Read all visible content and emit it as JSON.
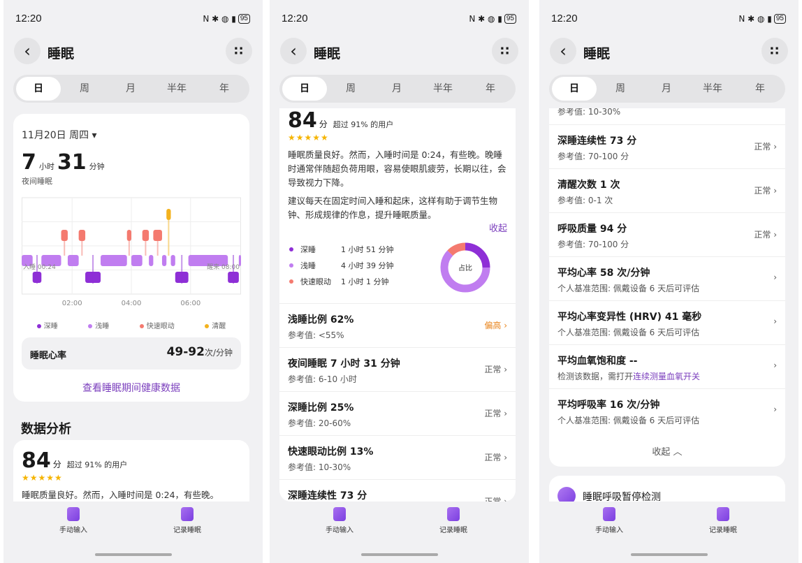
{
  "status": {
    "time": "12:20",
    "icons": "N ✱ ◍ ▮",
    "battery": "95"
  },
  "header": {
    "back": "‹",
    "title": "睡眠",
    "more": "∷"
  },
  "tabs": [
    "日",
    "周",
    "月",
    "半年",
    "年"
  ],
  "screen1": {
    "date": "11月20日 周四 ▾",
    "duration": {
      "hours": "7",
      "h_unit": "小时",
      "minutes": "31",
      "m_unit": "分钟"
    },
    "duration_label": "夜间睡眠",
    "chart_data": {
      "type": "area",
      "x_start_label": "入睡 00:24",
      "x_end_label": "醒来 08:00",
      "x_ticks": [
        "02:00",
        "04:00",
        "06:00"
      ],
      "legend": [
        "深睡",
        "浅睡",
        "快速眼动",
        "清醒"
      ],
      "colors": {
        "深睡": "#8e2fd6",
        "浅睡": "#c07df0",
        "快速眼动": "#f47a6f",
        "清醒": "#f3b21e"
      },
      "stages": [
        [
          "浅睡",
          0.0,
          0.05
        ],
        [
          "深睡",
          0.05,
          0.09
        ],
        [
          "浅睡",
          0.09,
          0.18
        ],
        [
          "快速眼动",
          0.18,
          0.21
        ],
        [
          "浅睡",
          0.21,
          0.26
        ],
        [
          "快速眼动",
          0.26,
          0.29
        ],
        [
          "深睡",
          0.29,
          0.36
        ],
        [
          "浅睡",
          0.36,
          0.48
        ],
        [
          "快速眼动",
          0.48,
          0.5
        ],
        [
          "浅睡",
          0.5,
          0.55
        ],
        [
          "快速眼动",
          0.55,
          0.58
        ],
        [
          "浅睡",
          0.58,
          0.6
        ],
        [
          "快速眼动",
          0.6,
          0.64
        ],
        [
          "浅睡",
          0.64,
          0.66
        ],
        [
          "清醒",
          0.66,
          0.68
        ],
        [
          "浅睡",
          0.68,
          0.7
        ],
        [
          "深睡",
          0.7,
          0.76
        ],
        [
          "浅睡",
          0.76,
          0.94
        ],
        [
          "深睡",
          0.94,
          0.99
        ],
        [
          "浅睡",
          0.99,
          1.0
        ]
      ]
    },
    "heart_rate": {
      "label": "睡眠心率",
      "value": "49-92",
      "unit": "次/分钟"
    },
    "link": "查看睡眠期间健康数据",
    "section_title": "数据分析"
  },
  "analysis": {
    "score": "84",
    "score_unit": "分",
    "beat": "超过 91% 的用户",
    "stars": "★★★★★",
    "para1": "睡眠质量良好。然而，入睡时间是 0:24，有些晚。晚睡时通常伴随超负荷用眼，容易使眼肌疲劳，长期以往，会导致视力下降。",
    "para1_short": "睡眠质量良好。然而，入睡时间是 0:24，有些晚。",
    "para2": "建议每天在固定时间入睡和起床，这样有助于调节生物钟、形成规律的作息，提升睡眠质量。",
    "collapse": "收起"
  },
  "composition": {
    "center": "占比",
    "items": [
      {
        "name": "深睡",
        "value": "1 小时 51 分钟",
        "color": "#8e2fd6",
        "pct": 25
      },
      {
        "name": "浅睡",
        "value": "4 小时 39 分钟",
        "color": "#c07df0",
        "pct": 62
      },
      {
        "name": "快速眼动",
        "value": "1 小时 1 分钟",
        "color": "#f47a6f",
        "pct": 13
      }
    ]
  },
  "metrics": [
    {
      "title": "浅睡比例 62%",
      "sub": "参考值: <55%",
      "status": "偏高 ›",
      "warn": true
    },
    {
      "title": "夜间睡眠 7 小时 31 分钟",
      "sub": "参考值: 6-10 小时",
      "status": "正常 ›"
    },
    {
      "title": "深睡比例 25%",
      "sub": "参考值: 20-60%",
      "status": "正常 ›"
    },
    {
      "title": "快速眼动比例 13%",
      "sub": "参考值: 10-30%",
      "status": "正常 ›"
    },
    {
      "title": "深睡连续性 73 分",
      "sub": "参考值: 70-100 分",
      "status": "正常 ›"
    },
    {
      "title": "清醒次数 1 次",
      "sub": "参考值: 0-1 次",
      "status": "正常 ›"
    },
    {
      "title": "呼吸质量 94 分",
      "sub": "参考值: 70-100 分",
      "status": "正常 ›"
    },
    {
      "title": "平均心率 58 次/分钟",
      "sub": "个人基准范围: 佩戴设备 6 天后可评估",
      "status": "›"
    },
    {
      "title": "平均心率变异性 (HRV) 41 毫秒",
      "sub": "个人基准范围: 佩戴设备 6 天后可评估",
      "status": "›"
    },
    {
      "title": "平均血氧饱和度 --",
      "sub": "检测该数据，需打开",
      "sub_link": "连续测量血氧开关",
      "status": "›"
    },
    {
      "title": "平均呼吸率 16 次/分钟",
      "sub": "个人基准范围: 佩戴设备 6 天后可评估",
      "status": "›"
    }
  ],
  "screen3": {
    "top_partial": "参考值: 10-30%",
    "collapse": "收起 ︿",
    "apnea_title": "睡眠呼吸暂停检测"
  },
  "bottom": {
    "manual": "手动输入",
    "record": "记录睡眠"
  }
}
